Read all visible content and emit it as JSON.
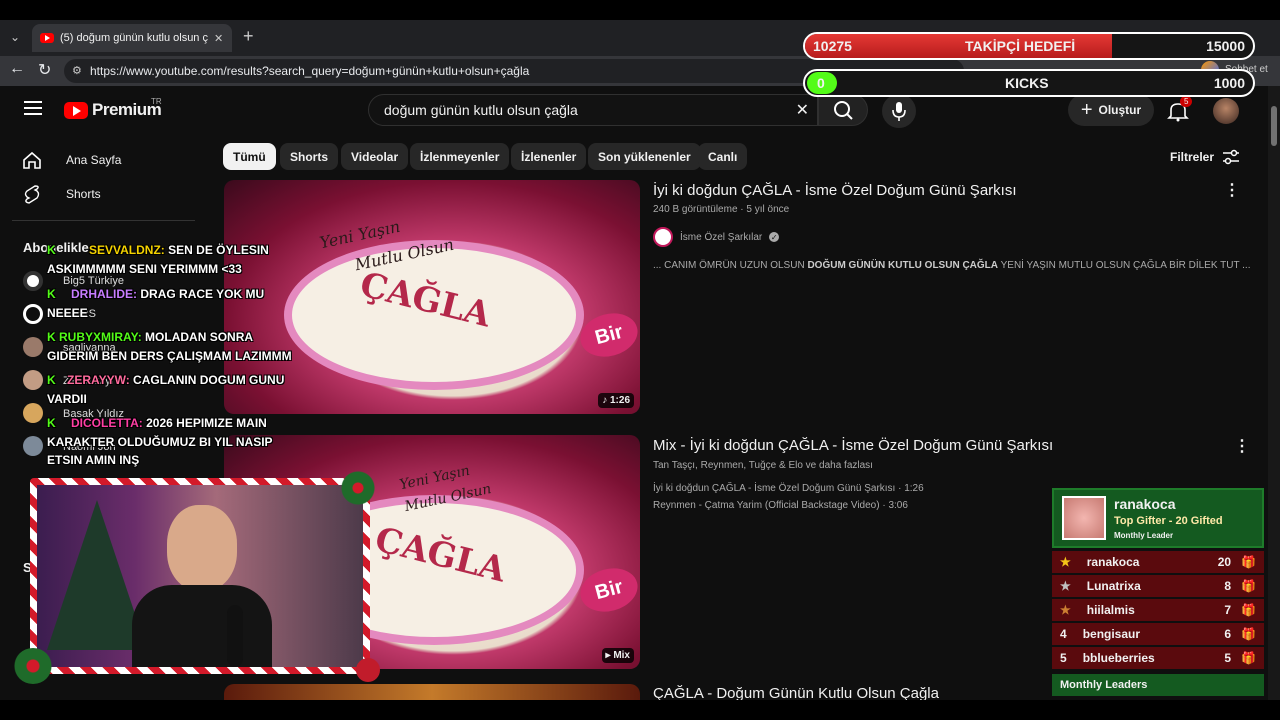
{
  "browser": {
    "tab_title": "(5) doğum günün kutlu olsun çağl",
    "url": "https://www.youtube.com/results?search_query=doğum+günün+kutlu+olsun+çağla",
    "chat_button": "Sohbet et"
  },
  "youtube": {
    "logo_text": "Premium",
    "region": "TR",
    "search_value": "doğum günün kutlu olsun çağla",
    "create_label": "Oluştur",
    "notif_count": "5",
    "filters_label": "Filtreler",
    "chips": [
      "Tümü",
      "Shorts",
      "Videolar",
      "İzlenmeyenler",
      "İzlenenler",
      "Son yüklenenler",
      "Canlı"
    ],
    "sidebar": {
      "home": "Ana Sayfa",
      "shorts": "Shorts",
      "subs_header": "Abonelikler",
      "section2": "S"
    },
    "subscriptions": [
      "Big5 Türkiye",
      "...ORS",
      "sagliyanna",
      "Zehra Kıyı",
      "Basak Yıldız",
      "Naomi Jon"
    ],
    "videos": [
      {
        "title": "İyi ki doğdun ÇAĞLA - İsme Özel Doğum Günü Şarkısı",
        "views": "240 B görüntüleme",
        "age": "5 yıl önce",
        "channel": "İsme Özel Şarkılar",
        "desc_pre": "... CANIM ÖMRÜN UZUN OLSUN ",
        "desc_bold": "DOĞUM GÜNÜN KUTLU OLSUN ÇAĞLA",
        "desc_post": " YENİ YAŞIN MUTLU OLSUN ÇAĞLA BİR DİLEK TUT ...",
        "duration": "1:26"
      },
      {
        "title": "Mix - İyi ki doğdun ÇAĞLA - İsme Özel Doğum Günü Şarkısı",
        "artists": "Tan Taşçı, Reynmen, Tuğçe & Elo ve daha fazlası",
        "item1": "İyi ki doğdun ÇAĞLA - İsme Özel Doğum Günü Şarkısı · 1:26",
        "item2": "Reynmen - Çatma Yarim (Official Backstage Video) · 3:06",
        "duration": "Mix"
      },
      {
        "title": "ÇAĞLA - Doğum Günün Kutlu Olsun Çağla"
      }
    ],
    "cake_text": [
      "Yeni Yaşın",
      "Mutlu Olsun",
      "ÇAĞLA",
      "Bir"
    ]
  },
  "stream": {
    "follower_current": "10275",
    "follower_label": "TAKİPÇİ HEDEFİ",
    "follower_goal": "15000",
    "follower_progress": 0.685,
    "kicks_current": "0",
    "kicks_label": "KICKS",
    "kicks_goal": "1000",
    "kicks_progress": 0.0,
    "chat": [
      {
        "user": "SEVVALDNZ:",
        "msg": "SEN DE ÖYLESIN",
        "cont": "ASKIMMMMM SENI YERIMMM <33",
        "color": "#f5d300"
      },
      {
        "user": "DRHALIDE:",
        "msg": "DRAG RACE YOK MU",
        "cont": "NEEEE",
        "color": "#c77dff"
      },
      {
        "user": "RUBYXMIRAY:",
        "msg": "MOLADAN SONRA",
        "cont": "GIDERIM BEN DERS ÇALIŞMAM LAZIMMM",
        "color": "#53fc18"
      },
      {
        "user": "ZERAYYW:",
        "msg": "CAGLANIN DOGUM GUNU",
        "cont": "VARDII",
        "color": "#ff6b9d"
      },
      {
        "user": "DICOLETTA:",
        "msg": "2026 HEPIMIZE MAIN",
        "cont": "KARAKTER OLDUĞUMUZ BI YIL NASIP",
        "cont2": "ETSIN AMIN INŞ",
        "color": "#ff3fa4"
      }
    ],
    "leader": {
      "name": "ranakoca",
      "title": "Top Gifter - 20 Gifted",
      "sub": "Monthly Leader"
    },
    "leaderboard": [
      {
        "rank": "★",
        "name": "ranakoca",
        "count": "20",
        "color": "#f5c518"
      },
      {
        "rank": "★",
        "name": "Lunatrixa",
        "count": "8",
        "color": "#c0c0c0"
      },
      {
        "rank": "★",
        "name": "hiilalmis",
        "count": "7",
        "color": "#cd7f32"
      },
      {
        "rank": "4",
        "name": "bengisaur",
        "count": "6",
        "color": "#ffffff"
      },
      {
        "rank": "5",
        "name": "bblueberries",
        "count": "5",
        "color": "#ffffff"
      }
    ],
    "leaderboard_footer": "Monthly Leaders"
  }
}
